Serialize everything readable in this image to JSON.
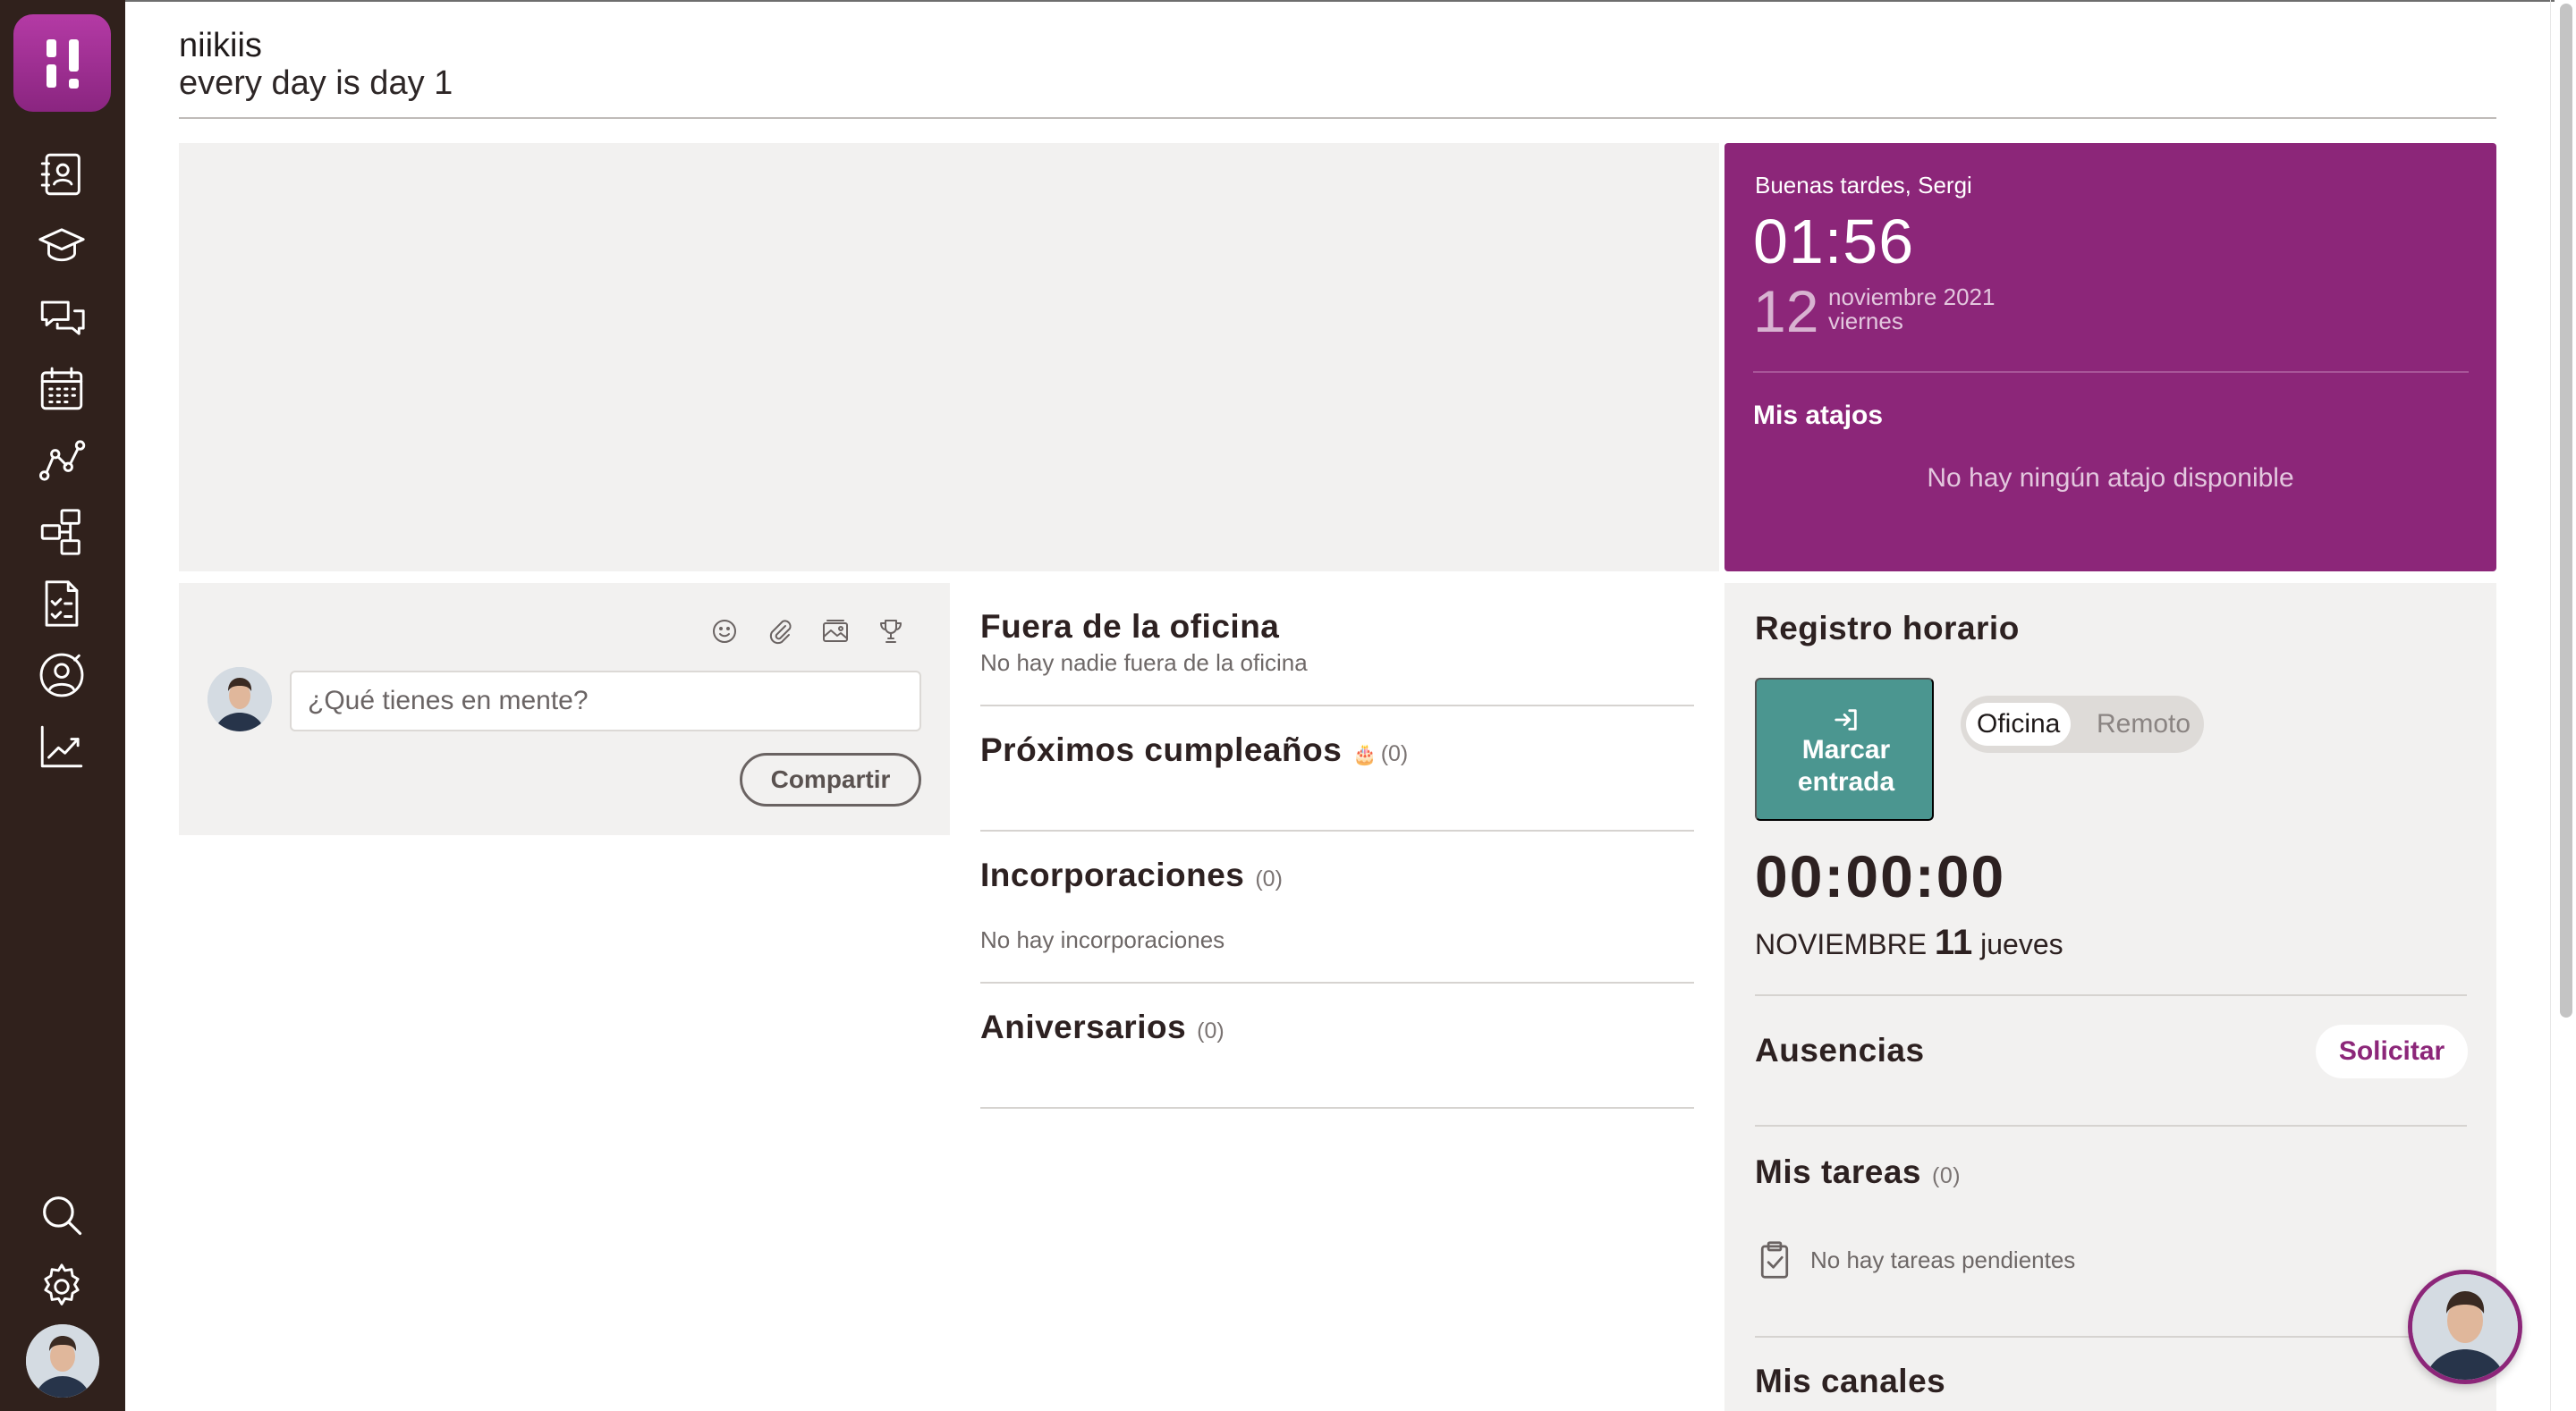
{
  "header": {
    "name": "niikiis",
    "subtitle": "every day is day 1"
  },
  "sidebar": {
    "items": [
      {
        "icon": "contacts-icon"
      },
      {
        "icon": "graduation-cap-icon"
      },
      {
        "icon": "chat-icon"
      },
      {
        "icon": "calendar-icon"
      },
      {
        "icon": "analytics-icon"
      },
      {
        "icon": "org-chart-icon"
      },
      {
        "icon": "checklist-icon"
      },
      {
        "icon": "support-icon"
      },
      {
        "icon": "reports-icon"
      }
    ],
    "bottom": [
      {
        "icon": "search-icon"
      },
      {
        "icon": "gear-icon"
      }
    ]
  },
  "greeting": {
    "hello": "Buenas tardes, Sergi",
    "time": "01:56",
    "day": "12",
    "month": "noviembre 2021",
    "weekday": "viernes",
    "shortcuts_title": "Mis atajos",
    "shortcuts_empty": "No hay ningún atajo disponible"
  },
  "post": {
    "placeholder": "¿Qué tienes en mente?",
    "share_label": "Compartir",
    "tools": [
      "emoji-icon",
      "paperclip-icon",
      "image-icon",
      "trophy-icon"
    ]
  },
  "middle": {
    "out_office": {
      "title": "Fuera de la oficina",
      "empty": "No hay nadie fuera de la oficina"
    },
    "birthdays": {
      "title": "Próximos cumpleaños",
      "emoji": "🎂",
      "count": "(0)"
    },
    "hires": {
      "title": "Incorporaciones",
      "count": "(0)",
      "empty": "No hay incorporaciones"
    },
    "anniversaries": {
      "title": "Aniversarios",
      "count": "(0)"
    }
  },
  "timesheet": {
    "title": "Registro horario",
    "clock_line1": "Marcar",
    "clock_line2": "entrada",
    "mode_on": "Oficina",
    "mode_off": "Remoto",
    "timer": "00:00:00",
    "date_month": "NOVIEMBRE",
    "date_day": "11",
    "date_weekday": "jueves",
    "absences_title": "Ausencias",
    "request_label": "Solicitar",
    "tasks_title": "Mis tareas",
    "tasks_count": "(0)",
    "tasks_empty": "No hay tareas pendientes",
    "channels_title": "Mis canales"
  },
  "colors": {
    "brand": "#8c2679",
    "sidebar": "#30211c",
    "clock_button": "#4b9690"
  }
}
